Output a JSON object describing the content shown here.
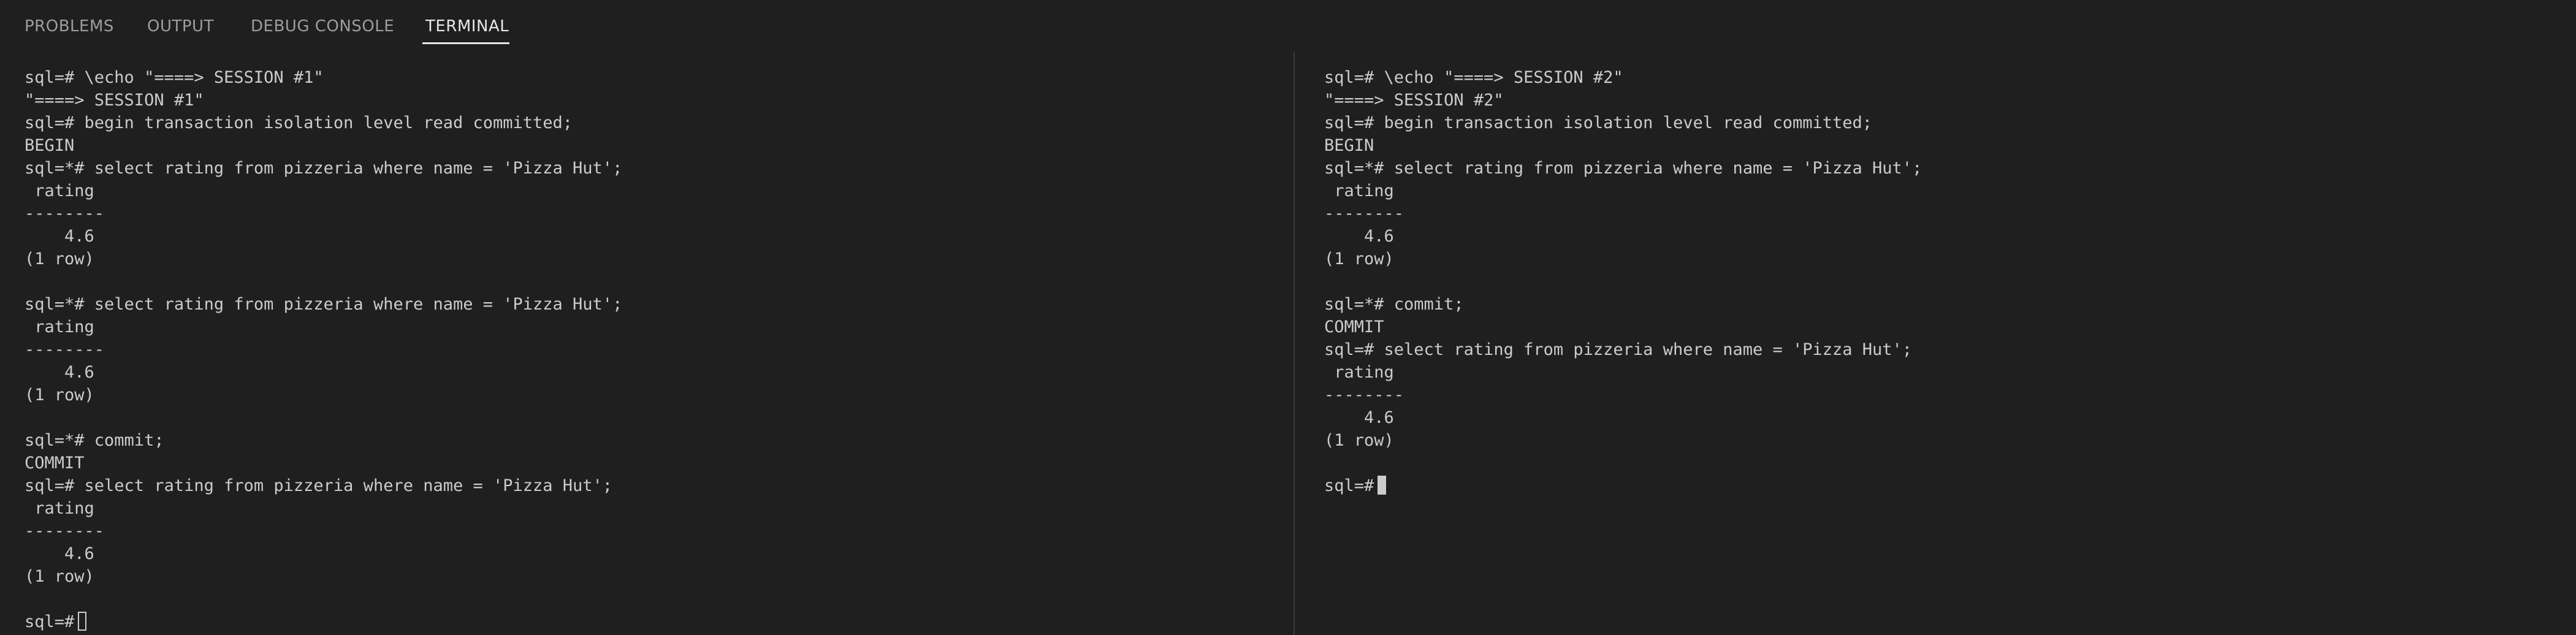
{
  "tabs": [
    {
      "label": "PROBLEMS",
      "active": false
    },
    {
      "label": "OUTPUT",
      "active": false
    },
    {
      "label": "DEBUG CONSOLE",
      "active": false
    },
    {
      "label": "TERMINAL",
      "active": true
    }
  ],
  "terminals": {
    "left": {
      "lines": [
        "sql=# \\echo \"====> SESSION #1\"",
        "\"====> SESSION #1\"",
        "sql=# begin transaction isolation level read committed;",
        "BEGIN",
        "sql=*# select rating from pizzeria where name = 'Pizza Hut';",
        " rating",
        "--------",
        "    4.6",
        "(1 row)",
        "",
        "sql=*# select rating from pizzeria where name = 'Pizza Hut';",
        " rating",
        "--------",
        "    4.6",
        "(1 row)",
        "",
        "sql=*# commit;",
        "COMMIT",
        "sql=# select rating from pizzeria where name = 'Pizza Hut';",
        " rating",
        "--------",
        "    4.6",
        "(1 row)",
        ""
      ],
      "prompt": "sql=#"
    },
    "right": {
      "lines": [
        "sql=# \\echo \"====> SESSION #2\"",
        "\"====> SESSION #2\"",
        "sql=# begin transaction isolation level read committed;",
        "BEGIN",
        "sql=*# select rating from pizzeria where name = 'Pizza Hut';",
        " rating",
        "--------",
        "    4.6",
        "(1 row)",
        "",
        "sql=*# commit;",
        "COMMIT",
        "sql=# select rating from pizzeria where name = 'Pizza Hut';",
        " rating",
        "--------",
        "    4.6",
        "(1 row)",
        ""
      ],
      "prompt": "sql=#"
    }
  },
  "colors": {
    "background": "#1f1f1f",
    "text": "#cccccc",
    "tab_inactive": "#9d9d9d",
    "tab_active": "#e7e7e7",
    "divider": "#3c3c3c"
  }
}
